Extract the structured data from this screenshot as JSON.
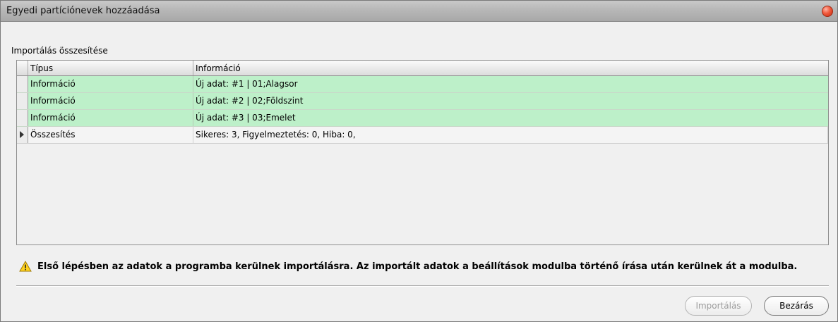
{
  "window": {
    "title": "Egyedi partíciónevek hozzáadása"
  },
  "section_label": "Importálás összesítése",
  "grid": {
    "columns": [
      "Típus",
      "Információ"
    ],
    "rows": [
      {
        "type": "Információ",
        "info": "Új adat: #1 | 01;Alagsor",
        "status": "ok"
      },
      {
        "type": "Információ",
        "info": "Új adat: #2 | 02;Földszint",
        "status": "ok"
      },
      {
        "type": "Információ",
        "info": "Új adat: #3 | 03;Emelet",
        "status": "ok"
      },
      {
        "type": "Összesítés",
        "info": "Sikeres: 3, Figyelmeztetés: 0, Hiba: 0,",
        "status": "summary"
      }
    ]
  },
  "warning": {
    "icon": "warning-triangle-icon",
    "text": "Első lépésben az adatok a programba kerülnek importálásra. Az importált adatok a beállítások modulba történő írása után kerülnek át a modulba."
  },
  "buttons": {
    "import_label": "Importálás",
    "import_enabled": false,
    "close_label": "Bezárás"
  },
  "colors": {
    "ok_row": "#bdf0c9",
    "close_button": "#e8452a"
  }
}
